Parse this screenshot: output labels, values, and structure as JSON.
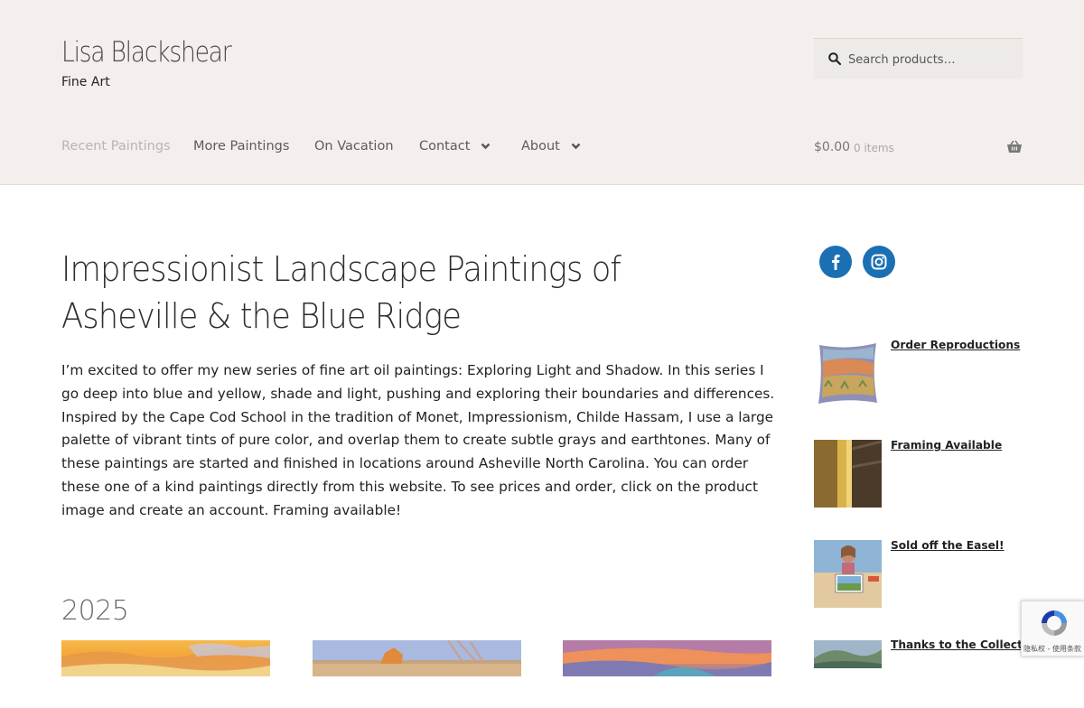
{
  "header": {
    "site_title": "Lisa Blackshear",
    "tagline": "Fine Art",
    "search_placeholder": "Search products…",
    "nav": [
      {
        "label": "Recent Paintings",
        "active": true,
        "has_dropdown": false
      },
      {
        "label": "More Paintings",
        "active": false,
        "has_dropdown": false
      },
      {
        "label": "On Vacation",
        "active": false,
        "has_dropdown": false
      },
      {
        "label": "Contact",
        "active": false,
        "has_dropdown": true
      },
      {
        "label": "About",
        "active": false,
        "has_dropdown": true
      }
    ],
    "cart": {
      "amount": "$0.00",
      "count": "0 items"
    }
  },
  "main": {
    "title": "Impressionist Landscape Paintings of Asheville & the Blue Ridge",
    "intro": "I’m excited to offer my new series of fine art oil paintings: Exploring Light and Shadow. In this series I go deep into blue and yellow, shade and light, pushing and exploring their boundaries and differences. Inspired by the Cape Cod School in the tradition of Monet, Impressionism, Childe Hassam, I use a large palette of vibrant tints of pure color, and overlap them to create subtle grays and earthtones. Many of these paintings are started and finished in locations around Asheville North Carolina. You can order these one of a kind paintings directly from this website. To see prices and order, click on the product image and create an account. Framing available!",
    "year_heading": "2025"
  },
  "sidebar": {
    "social": [
      {
        "name": "facebook-icon"
      },
      {
        "name": "instagram-icon"
      }
    ],
    "widgets": [
      {
        "label": "Order Reproductions"
      },
      {
        "label": "Framing Available"
      },
      {
        "label": "Sold off the Easel!"
      },
      {
        "label": "Thanks to the Collectors"
      }
    ]
  },
  "recaptcha": {
    "text": "隐私权 - 使用条款"
  },
  "colors": {
    "header_bg": "#f4efec",
    "social_blue": "#1b6fb3",
    "nav_active": "#b5b5b5",
    "nav_text": "#5c5c5c"
  }
}
